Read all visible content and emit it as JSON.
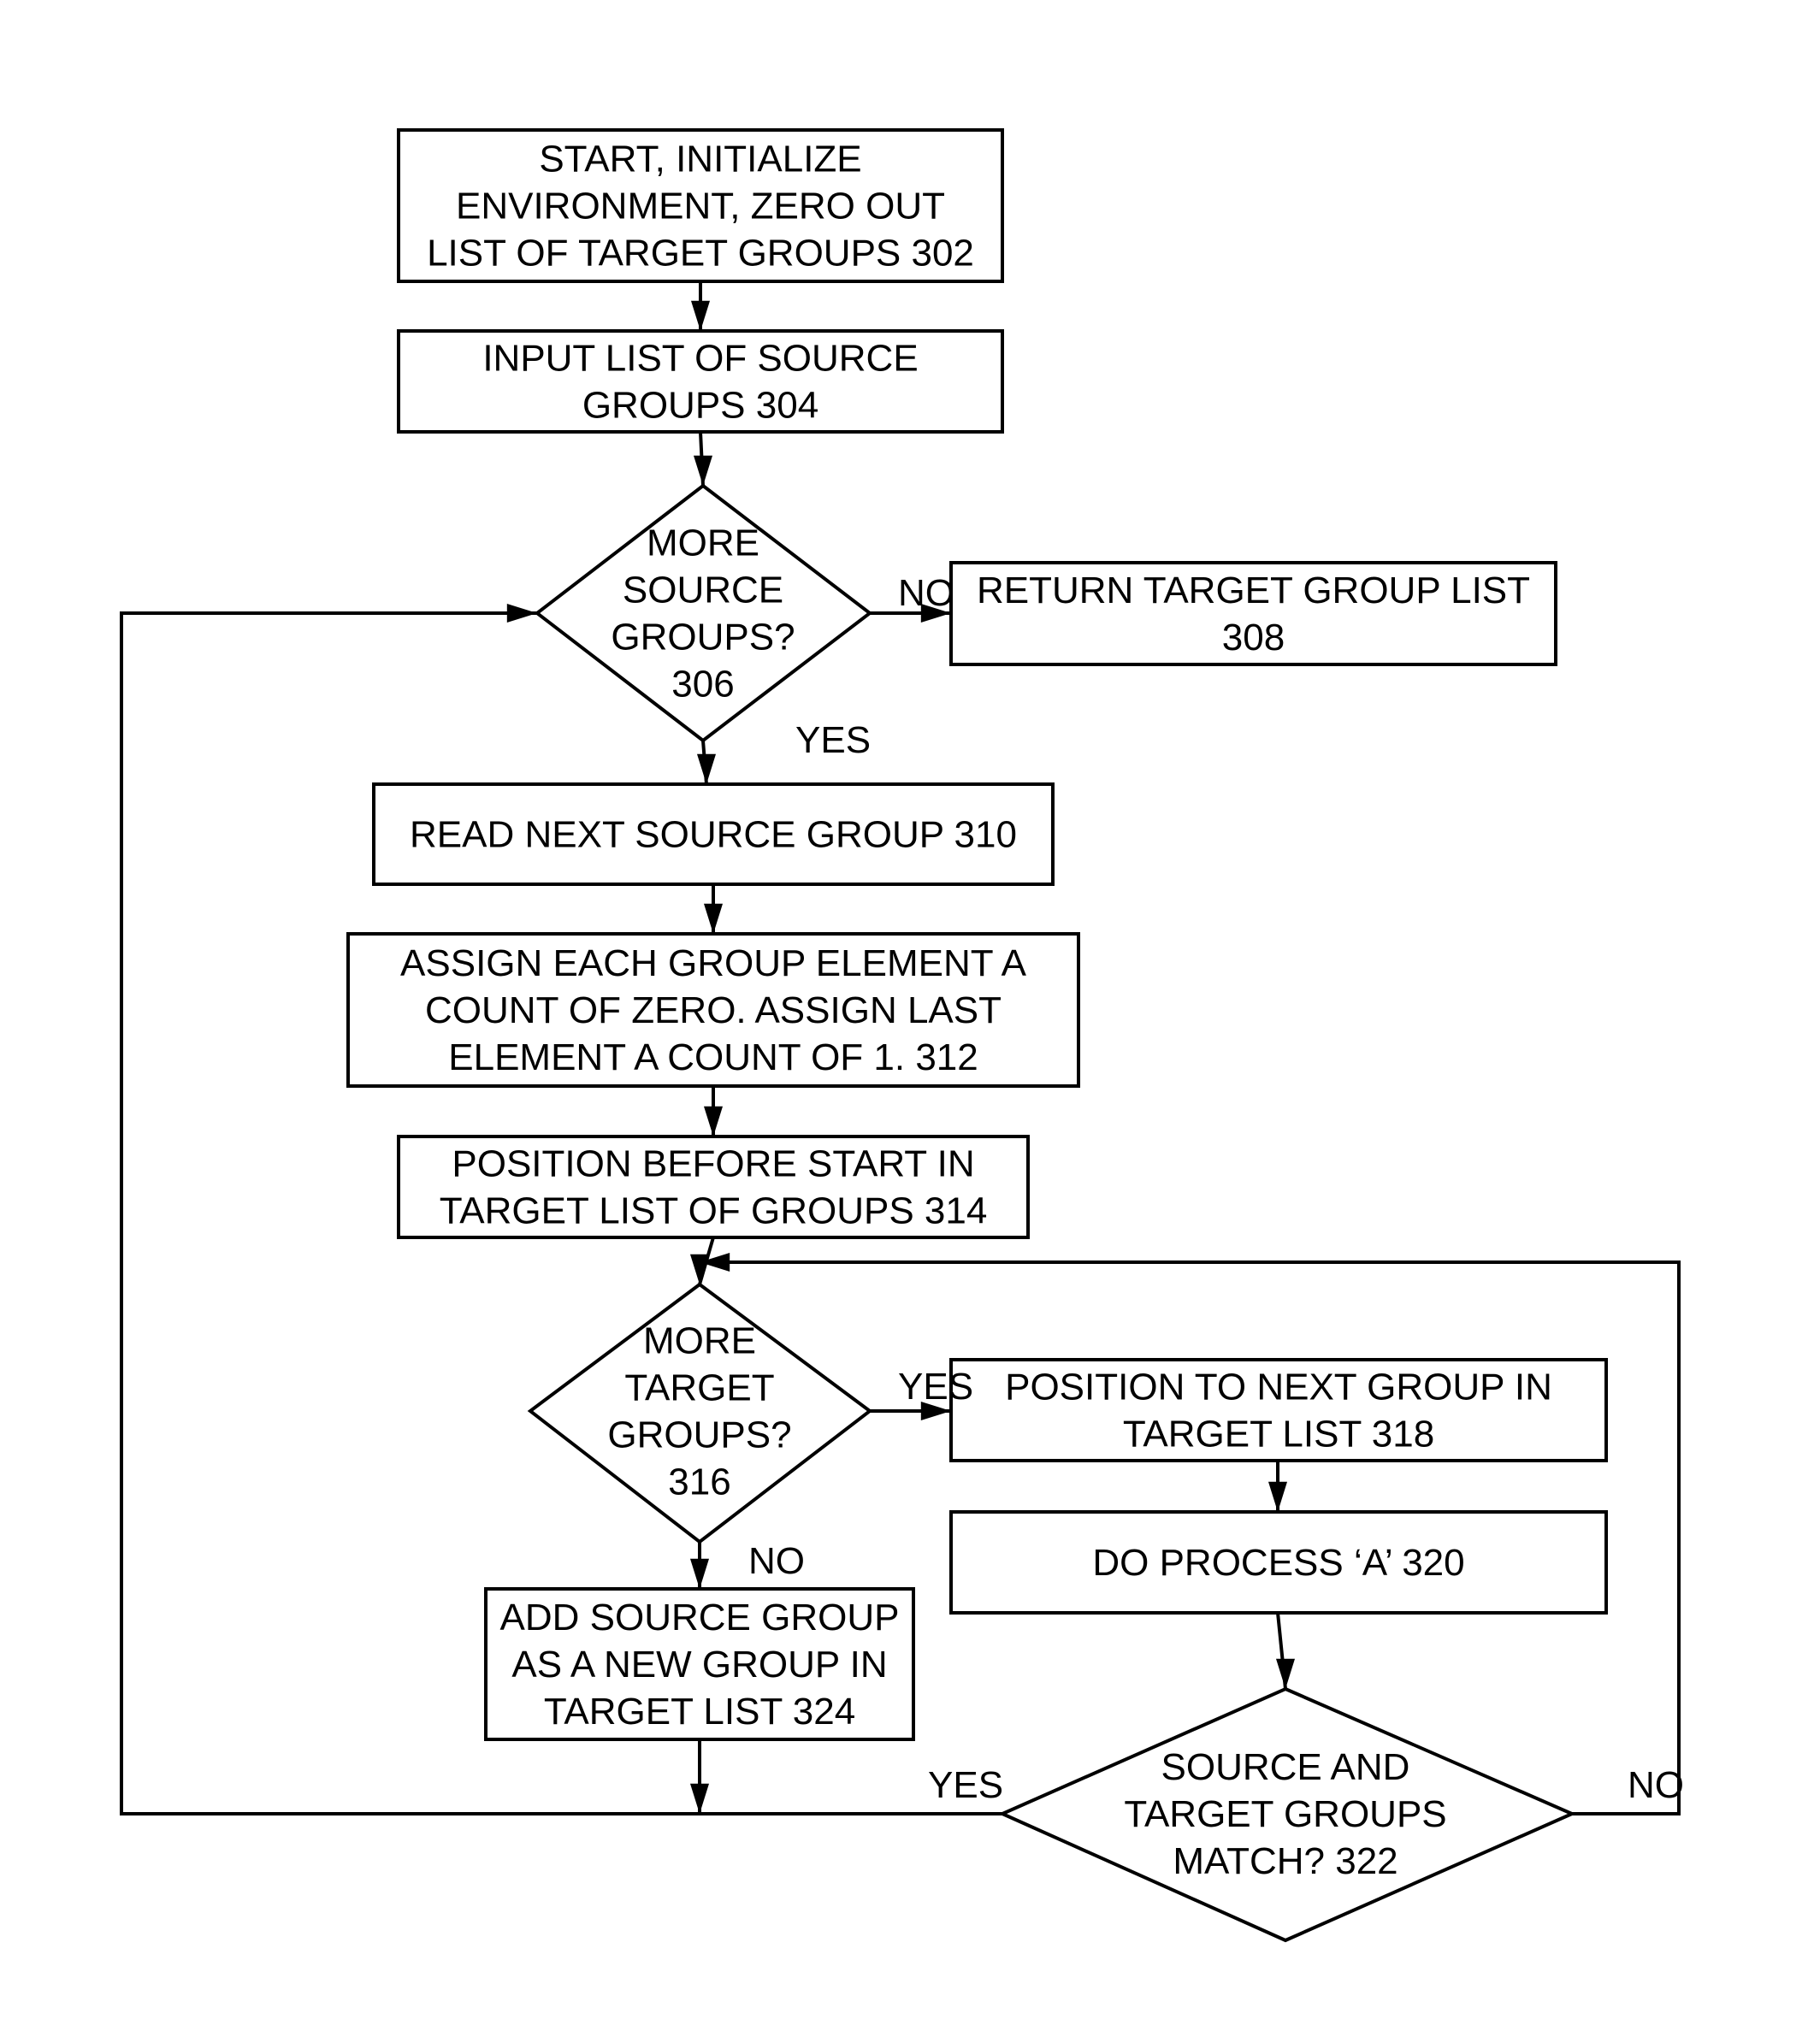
{
  "diagram": {
    "type": "flowchart",
    "nodes": [
      {
        "id": "302",
        "shape": "box",
        "lines": [
          "START, INITIALIZE",
          "ENVIRONMENT, ZERO OUT",
          "LIST OF TARGET GROUPS 302"
        ]
      },
      {
        "id": "304",
        "shape": "box",
        "lines": [
          "INPUT LIST OF SOURCE",
          "GROUPS 304"
        ]
      },
      {
        "id": "306",
        "shape": "diamond",
        "lines": [
          "MORE",
          "SOURCE",
          "GROUPS?",
          "306"
        ]
      },
      {
        "id": "308",
        "shape": "box",
        "lines": [
          "RETURN TARGET GROUP LIST",
          "308"
        ]
      },
      {
        "id": "310",
        "shape": "box",
        "lines": [
          "READ NEXT SOURCE GROUP 310"
        ]
      },
      {
        "id": "312",
        "shape": "box",
        "lines": [
          "ASSIGN EACH GROUP ELEMENT A",
          "COUNT OF ZERO. ASSIGN LAST",
          "ELEMENT A COUNT OF 1. 312"
        ]
      },
      {
        "id": "314",
        "shape": "box",
        "lines": [
          "POSITION BEFORE START IN",
          "TARGET LIST OF GROUPS 314"
        ]
      },
      {
        "id": "316",
        "shape": "diamond",
        "lines": [
          "MORE",
          "TARGET",
          "GROUPS?",
          "316"
        ]
      },
      {
        "id": "318",
        "shape": "box",
        "lines": [
          "POSITION TO NEXT GROUP IN",
          "TARGET LIST 318"
        ]
      },
      {
        "id": "320",
        "shape": "box",
        "lines": [
          "DO PROCESS ‘A’ 320"
        ]
      },
      {
        "id": "322",
        "shape": "diamond",
        "lines": [
          "SOURCE AND",
          "TARGET GROUPS",
          "MATCH? 322"
        ]
      },
      {
        "id": "324",
        "shape": "box",
        "lines": [
          "ADD SOURCE GROUP",
          "AS A NEW GROUP IN",
          "TARGET LIST 324"
        ]
      }
    ],
    "edges": [
      {
        "from": "302",
        "to": "304",
        "label": ""
      },
      {
        "from": "304",
        "to": "306",
        "label": ""
      },
      {
        "from": "306",
        "to": "308",
        "label": "NO"
      },
      {
        "from": "306",
        "to": "310",
        "label": "YES"
      },
      {
        "from": "310",
        "to": "312",
        "label": ""
      },
      {
        "from": "312",
        "to": "314",
        "label": ""
      },
      {
        "from": "314",
        "to": "316",
        "label": ""
      },
      {
        "from": "316",
        "to": "318",
        "label": "YES"
      },
      {
        "from": "316",
        "to": "324",
        "label": "NO"
      },
      {
        "from": "318",
        "to": "320",
        "label": ""
      },
      {
        "from": "320",
        "to": "322",
        "label": ""
      },
      {
        "from": "322",
        "to": "306",
        "label": "YES"
      },
      {
        "from": "322",
        "to": "316",
        "label": "NO"
      },
      {
        "from": "324",
        "to": "306",
        "label": ""
      }
    ]
  }
}
